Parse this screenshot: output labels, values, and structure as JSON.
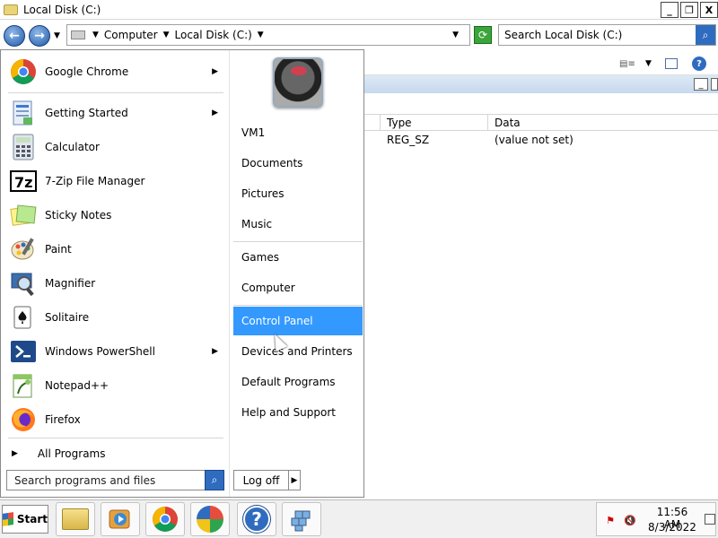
{
  "window": {
    "title": "Local Disk (C:)",
    "controls": [
      "_",
      "❐",
      "X"
    ]
  },
  "address": {
    "crumbs": [
      "Computer",
      "Local Disk (C:)"
    ],
    "search_placeholder": "Search Local Disk (C:)"
  },
  "registry": {
    "columns": [
      "Type",
      "Data"
    ],
    "row": {
      "type": "REG_SZ",
      "data": "(value not set)"
    }
  },
  "start_menu": {
    "programs": [
      {
        "label": "Google Chrome",
        "icon": "chrome-icon",
        "arrow": true
      },
      {
        "label": "Getting Started",
        "icon": "getting-started-icon",
        "arrow": true
      },
      {
        "label": "Calculator",
        "icon": "calculator-icon",
        "arrow": false
      },
      {
        "label": "7-Zip File Manager",
        "icon": "7zip-icon",
        "arrow": false
      },
      {
        "label": "Sticky Notes",
        "icon": "sticky-notes-icon",
        "arrow": false
      },
      {
        "label": "Paint",
        "icon": "paint-icon",
        "arrow": false
      },
      {
        "label": "Magnifier",
        "icon": "magnifier-icon",
        "arrow": false
      },
      {
        "label": "Solitaire",
        "icon": "solitaire-icon",
        "arrow": false
      },
      {
        "label": "Windows PowerShell",
        "icon": "powershell-icon",
        "arrow": true
      },
      {
        "label": "Notepad++",
        "icon": "notepadpp-icon",
        "arrow": false
      },
      {
        "label": "Firefox",
        "icon": "firefox-icon",
        "arrow": false
      }
    ],
    "all_programs": "All Programs",
    "search_placeholder": "Search programs and files",
    "right_items": [
      {
        "label": "VM1"
      },
      {
        "label": "Documents"
      },
      {
        "label": "Pictures"
      },
      {
        "label": "Music"
      },
      {
        "label": "Games"
      },
      {
        "label": "Computer"
      },
      {
        "label": "Control Panel",
        "highlighted": true
      },
      {
        "label": "Devices and Printers"
      },
      {
        "label": "Default Programs"
      },
      {
        "label": "Help and Support"
      }
    ],
    "log_off": "Log off"
  },
  "taskbar": {
    "start_label": "Start",
    "pinned": [
      "explorer-icon",
      "media-player-icon",
      "chrome-icon",
      "windows-update-icon",
      "help-icon",
      "registry-editor-icon"
    ],
    "time": "11:56 AM",
    "date": "8/3/2022"
  }
}
